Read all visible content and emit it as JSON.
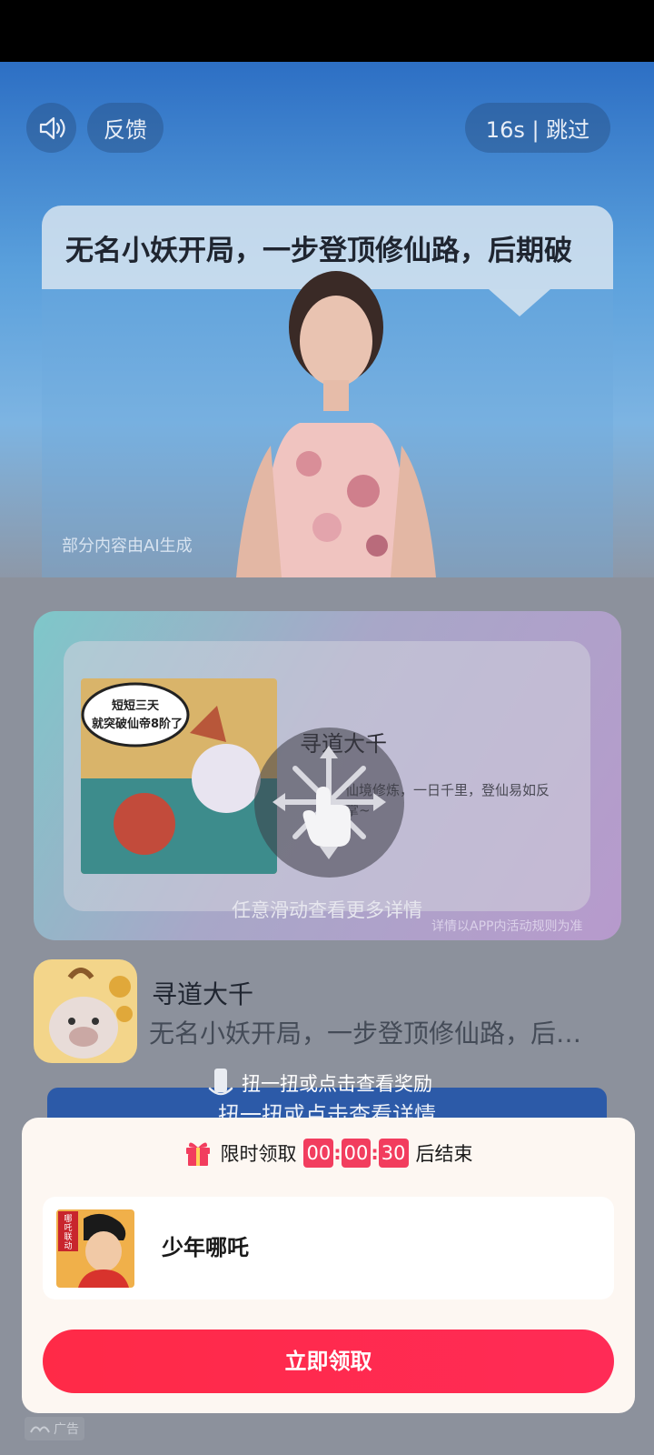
{
  "top_controls": {
    "feedback_label": "反馈",
    "skip_label": "16s | 跳过",
    "sound_icon": "speaker-icon"
  },
  "video": {
    "caption": "无名小妖开局，一步登顶修仙路，后期破",
    "ai_note": "部分内容由AI生成"
  },
  "card": {
    "image_text": [
      "短短三天",
      "就突破仙帝8阶了"
    ],
    "game_title": "寻道大千",
    "game_desc": "仙境修炼，一日千里，登仙易如反掌~",
    "swipe_hint": "任意滑动查看更多详情",
    "terms": "详情以APP内活动规则为准"
  },
  "app": {
    "name": "寻道大千",
    "description": "无名小妖开局，一步登顶修仙路，后期破..."
  },
  "shake": {
    "hint": "扭一扭或点击查看奖励",
    "detail_button": "扭一扭或点击查看详情"
  },
  "reward": {
    "timer_prefix": "限时领取",
    "timer_suffix": "后结束",
    "hours": "00",
    "minutes": "00",
    "seconds": "30",
    "reward_name": "少年哪吒",
    "reward_image_text": "哪吒联动",
    "claim_label": "立即领取"
  },
  "ad_label": "广告",
  "colors": {
    "accent_red": "#f23d5e",
    "claim_button": "#ff2a47",
    "detail_button": "#2c5aa8"
  }
}
